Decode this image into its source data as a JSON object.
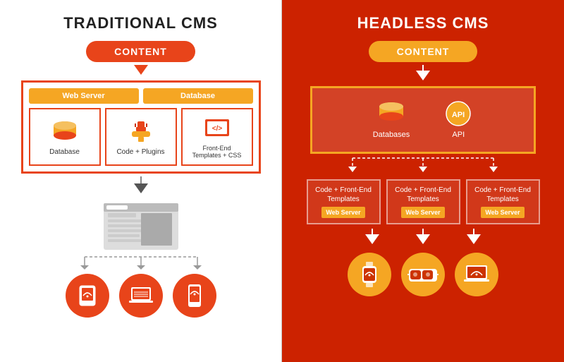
{
  "left": {
    "title": "TRADITIONAL CMS",
    "content_label": "CONTENT",
    "web_server_label": "Web Server",
    "database_header_label": "Database",
    "icons": [
      {
        "label": "Database"
      },
      {
        "label": "Code + Plugins"
      },
      {
        "label": "Front-End\nTemplates + CSS"
      }
    ],
    "devices": [
      "tablet",
      "laptop",
      "phone"
    ]
  },
  "right": {
    "title": "HEADLESS CMS",
    "content_label": "CONTENT",
    "icons": [
      {
        "label": "Databases"
      },
      {
        "label": "API"
      }
    ],
    "webservers": [
      {
        "code_label": "Code + Front-End\nTemplates",
        "ws_label": "Web Server"
      },
      {
        "code_label": "Code + Front-End\nTemplates",
        "ws_label": "Web Server"
      },
      {
        "code_label": "Code + Front-End\nTemplates",
        "ws_label": "Web Server"
      }
    ],
    "devices": [
      "watch",
      "vr-glasses",
      "laptop"
    ]
  }
}
